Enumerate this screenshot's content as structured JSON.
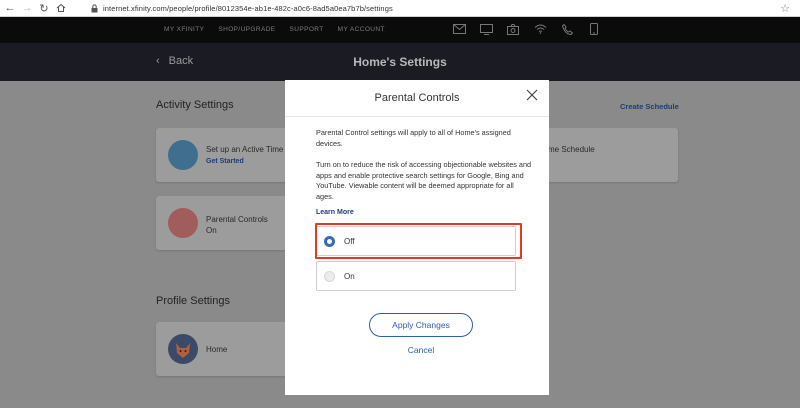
{
  "browser": {
    "url": "internet.xfinity.com/people/profile/8012354e-ab1e-482c-a0c6-8ad5a0ea7b7b/settings"
  },
  "topnav": {
    "links": [
      "MY XFINITY",
      "SHOP/UPGRADE",
      "SUPPORT",
      "MY ACCOUNT"
    ]
  },
  "header": {
    "back_label": "Back",
    "title": "Home's Settings"
  },
  "activity": {
    "title": "Activity Settings",
    "create_schedule": "Create Schedule",
    "active_time": {
      "label": "Set up an Active Time",
      "action": "Get Started"
    },
    "home_schedule": {
      "label": "me Schedule"
    },
    "parental": {
      "label": "Parental Controls",
      "status": "On"
    }
  },
  "profile": {
    "title": "Profile Settings",
    "name": "Home"
  },
  "modal": {
    "title": "Parental Controls",
    "intro": "Parental Control settings will apply to all of Home's assigned devices.",
    "description": "Turn on to reduce the risk of accessing objectionable websites and apps and enable protective search settings for Google, Bing and YouTube. Viewable content will be deemed appropriate for all ages.",
    "learn_more": "Learn More",
    "options": [
      {
        "label": "Off",
        "selected": true
      },
      {
        "label": "On",
        "selected": false
      }
    ],
    "apply_label": "Apply Changes",
    "cancel_label": "Cancel"
  },
  "colors": {
    "accent": "#2f5ea8",
    "highlight": "#e03a22"
  }
}
